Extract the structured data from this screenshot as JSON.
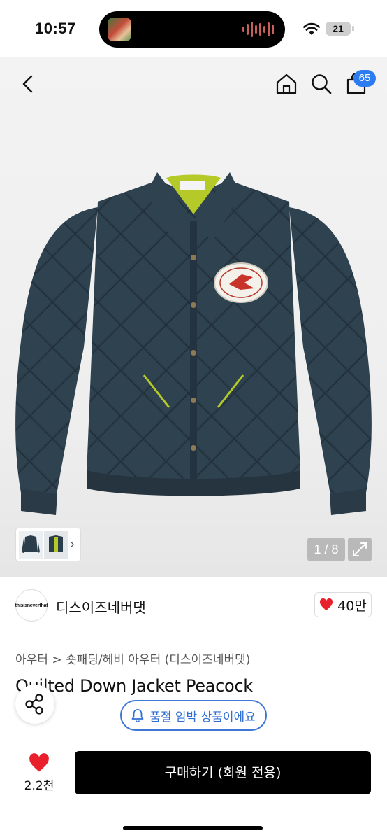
{
  "status_bar": {
    "time": "10:57",
    "battery": "21"
  },
  "header": {
    "cart_count": "65"
  },
  "gallery": {
    "counter": "1 / 8"
  },
  "seller": {
    "logo_text": "thisisneverthat",
    "name": "디스이즈네버댓",
    "likes": "40만"
  },
  "product": {
    "category": "아우터 > 숏패딩/헤비 아우터 (디스이즈네버댓)",
    "title": "Quilted Down Jacket Peacock",
    "stock_notice": "품절 임박 상품이에요"
  },
  "bottom_bar": {
    "wish_count": "2.2천",
    "buy_label": "구매하기 (회원 전용)"
  },
  "colors": {
    "accent_blue": "#2d7bf0",
    "heart_red": "#e8202b",
    "jacket_navy": "#2a3c49",
    "lining_lime": "#b5c928"
  },
  "icons": [
    "back-icon",
    "home-icon",
    "search-icon",
    "shopping-bag-icon",
    "expand-icon",
    "heart-icon",
    "share-icon",
    "bell-icon"
  ]
}
